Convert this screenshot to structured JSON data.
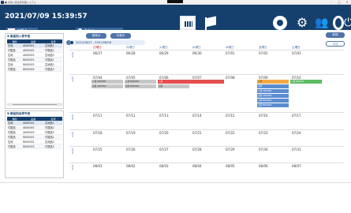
{
  "window": {
    "title": "■ 専用入荷出荷管理システム"
  },
  "header": {
    "datetime": "2021/07/09 15:39:57",
    "user": "工場 A",
    "dept": "Ashog"
  },
  "left": {
    "panel1_title": "▼ 部品別入荷予定",
    "panel2_title": "▼ 部品別出荷予定",
    "columns": [
      "種別",
      "品番",
      "名称"
    ],
    "rows1": [
      [
        "生地",
        "A000001",
        "生地品1"
      ],
      [
        "付属品",
        "A000002",
        "付属品2"
      ],
      [
        "生地",
        "A000003",
        "生地品3"
      ],
      [
        "付属品",
        "B000001",
        "付属品1"
      ],
      [
        "生地",
        "B000002",
        "生地品2"
      ],
      [
        "付属品",
        "B000003",
        "付属品3"
      ]
    ],
    "rows2": [
      [
        "生地",
        "A000001",
        "生地品1"
      ],
      [
        "付属品",
        "A000002",
        "付属品2"
      ],
      [
        "付属品",
        "A000003",
        "付属品3"
      ],
      [
        "付属品",
        "B000001",
        "付属品1"
      ],
      [
        "生地",
        "B000002",
        "生地品2"
      ],
      [
        "付属品",
        "B000003",
        "付属品3"
      ]
    ]
  },
  "controls": {
    "week_btn": "週表示",
    "month_btn": "月表示",
    "range": "2021/06/27 - 2021/08/08",
    "new_btn": "新規",
    "today_btn": "今日"
  },
  "calendar": {
    "dow": [
      "日曜日",
      "月曜日",
      "火曜日",
      "水曜日",
      "木曜日",
      "金曜日",
      "土曜日"
    ],
    "weeks": [
      {
        "label": "W26",
        "days": [
          "06/27",
          "06/28",
          "06/29",
          "06/30",
          "07/01",
          "07/02",
          "07/03"
        ]
      },
      {
        "label": "W27",
        "days": [
          "07/04",
          "07/05",
          "07/06",
          "07/07",
          "07/08",
          "07/09",
          "07/10"
        ]
      },
      {
        "label": "W28",
        "days": [
          "07/11",
          "07/12",
          "07/13",
          "07/14",
          "07/15",
          "07/16",
          "07/17"
        ]
      },
      {
        "label": "W29",
        "days": [
          "07/18",
          "07/19",
          "07/20",
          "07/21",
          "07/22",
          "07/23",
          "07/24"
        ]
      },
      {
        "label": "W30",
        "days": [
          "07/25",
          "07/26",
          "07/27",
          "07/28",
          "07/29",
          "07/30",
          "07/31"
        ]
      },
      {
        "label": "W31",
        "days": [
          "08/01",
          "08/02",
          "08/03",
          "08/04",
          "08/05",
          "08/06",
          "08/07"
        ]
      }
    ],
    "events": {
      "e1": "入荷 A000001",
      "e2": "出荷 A000002",
      "e3": "入荷 B000001",
      "e4": "出荷 B000002",
      "e5": "入荷",
      "e6": "出荷",
      "e7": "入荷 B00003"
    }
  }
}
